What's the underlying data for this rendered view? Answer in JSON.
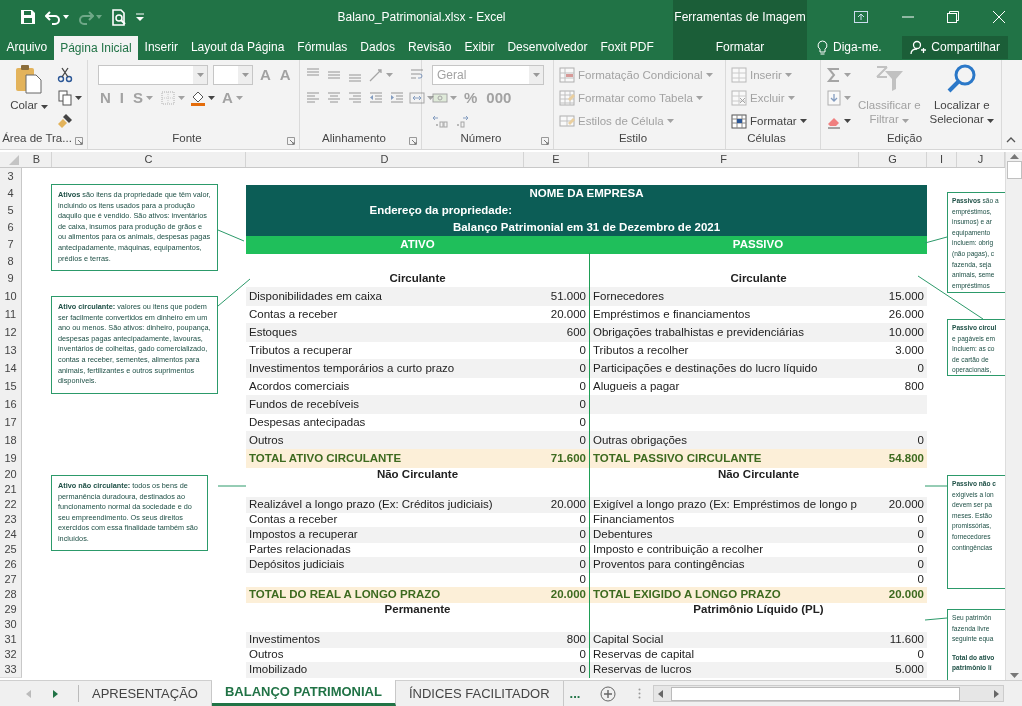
{
  "title_bar": {
    "title": "Balano_Patrimonial.xlsx - Excel",
    "context_title": "Ferramentas de Imagem"
  },
  "ribbon_tabs": [
    {
      "label": "Arquivo",
      "selected": false,
      "kind": "normal"
    },
    {
      "label": "Página Inicial",
      "selected": true,
      "kind": "normal"
    },
    {
      "label": "Inserir",
      "selected": false,
      "kind": "normal"
    },
    {
      "label": "Layout da Página",
      "selected": false,
      "kind": "normal"
    },
    {
      "label": "Fórmulas",
      "selected": false,
      "kind": "normal"
    },
    {
      "label": "Dados",
      "selected": false,
      "kind": "normal"
    },
    {
      "label": "Revisão",
      "selected": false,
      "kind": "normal"
    },
    {
      "label": "Exibir",
      "selected": false,
      "kind": "normal"
    },
    {
      "label": "Desenvolvedor",
      "selected": false,
      "kind": "normal"
    },
    {
      "label": "Foxit PDF",
      "selected": false,
      "kind": "normal"
    },
    {
      "label": "Formatar",
      "selected": false,
      "kind": "contextual"
    }
  ],
  "tell_me": "Diga-me.",
  "share": "Compartilhar",
  "ribbon_groups": [
    {
      "label": "Área de Tra...",
      "launcher": true,
      "parts": [
        {
          "kind": "large",
          "label": "Colar",
          "dropdown": true,
          "disabled": false
        },
        {
          "kind": "stack",
          "lines": [
            [
              {
                "kind": "icon",
                "dropdown": false,
                "disabled": false
              }
            ],
            [
              {
                "kind": "icon",
                "dropdown": true,
                "disabled": false
              }
            ],
            [
              {
                "kind": "icon",
                "dropdown": false,
                "disabled": false
              }
            ]
          ]
        }
      ]
    },
    {
      "label": "Fonte",
      "launcher": true,
      "parts": [
        {
          "kind": "stack",
          "lines": [
            [
              {
                "kind": "combo",
                "dropdown": true,
                "disabled": true
              },
              {
                "kind": "narrow-combo",
                "dropdown": true,
                "disabled": true
              },
              {
                "kind": "letter",
                "label": "A",
                "dropdown": false,
                "disabled": true
              },
              {
                "kind": "letter",
                "label": "A",
                "dropdown": false,
                "disabled": true
              }
            ],
            [
              {
                "kind": "letter",
                "label": "N",
                "dropdown": false,
                "disabled": true
              },
              {
                "kind": "letter",
                "label": "I",
                "dropdown": false,
                "disabled": true
              },
              {
                "kind": "letter",
                "label": "S",
                "dropdown": true,
                "disabled": true
              },
              {
                "kind": "icon",
                "dropdown": true,
                "disabled": true
              },
              {
                "kind": "icon",
                "dropdown": true,
                "disabled": false
              },
              {
                "kind": "letter",
                "label": "A",
                "dropdown": true,
                "disabled": true
              }
            ]
          ]
        }
      ]
    },
    {
      "label": "Alinhamento",
      "launcher": true,
      "parts": [
        {
          "kind": "stack",
          "lines": [
            [
              {
                "kind": "icon",
                "dropdown": false,
                "disabled": true
              },
              {
                "kind": "icon",
                "dropdown": false,
                "disabled": true
              },
              {
                "kind": "icon",
                "dropdown": false,
                "disabled": true
              },
              {
                "kind": "icon",
                "dropdown": true,
                "disabled": true
              }
            ],
            [
              {
                "kind": "icon",
                "dropdown": false,
                "disabled": true
              },
              {
                "kind": "icon",
                "dropdown": false,
                "disabled": true
              },
              {
                "kind": "icon",
                "dropdown": false,
                "disabled": true
              },
              {
                "kind": "icon",
                "dropdown": false,
                "disabled": true
              },
              {
                "kind": "icon",
                "dropdown": false,
                "disabled": true
              }
            ]
          ]
        },
        {
          "kind": "stack",
          "lines": [
            [
              {
                "kind": "icon",
                "dropdown": false,
                "disabled": true
              }
            ],
            [
              {
                "kind": "icon",
                "dropdown": true,
                "disabled": true
              }
            ]
          ]
        }
      ]
    },
    {
      "label": "Número",
      "launcher": true,
      "parts": [
        {
          "kind": "stack",
          "lines": [
            [
              {
                "kind": "combo",
                "value": "Geral",
                "dropdown": true,
                "disabled": true
              }
            ],
            [
              {
                "kind": "icon",
                "dropdown": true,
                "disabled": true
              },
              {
                "kind": "letter",
                "label": "%",
                "dropdown": false,
                "disabled": true
              },
              {
                "kind": "letter",
                "label": "000",
                "dropdown": false,
                "disabled": true
              }
            ],
            [
              {
                "kind": "icon",
                "dropdown": false,
                "disabled": true
              },
              {
                "kind": "icon",
                "dropdown": false,
                "disabled": true
              }
            ]
          ]
        }
      ]
    },
    {
      "label": "Estilo",
      "launcher": false,
      "parts": [
        {
          "kind": "stack",
          "lines": [
            [
              {
                "kind": "labeled",
                "label": "Formatação Condicional",
                "dropdown": true,
                "disabled": true
              }
            ],
            [
              {
                "kind": "labeled",
                "label": "Formatar como Tabela",
                "dropdown": true,
                "disabled": true
              }
            ],
            [
              {
                "kind": "labeled",
                "label": "Estilos de Célula",
                "dropdown": true,
                "disabled": true
              }
            ]
          ]
        }
      ]
    },
    {
      "label": "Células",
      "launcher": false,
      "parts": [
        {
          "kind": "stack",
          "lines": [
            [
              {
                "kind": "labeled",
                "label": "Inserir",
                "dropdown": true,
                "disabled": true
              }
            ],
            [
              {
                "kind": "labeled",
                "label": "Excluir",
                "dropdown": true,
                "disabled": true
              }
            ],
            [
              {
                "kind": "labeled",
                "label": "Formatar",
                "dropdown": true,
                "disabled": false
              }
            ]
          ]
        }
      ]
    },
    {
      "label": "Edição",
      "launcher": false,
      "parts": [
        {
          "kind": "stack",
          "lines": [
            [
              {
                "kind": "icon",
                "dropdown": true,
                "disabled": true
              }
            ],
            [
              {
                "kind": "icon",
                "dropdown": true,
                "disabled": true
              }
            ],
            [
              {
                "kind": "icon",
                "dropdown": true,
                "disabled": false
              }
            ]
          ]
        },
        {
          "kind": "large",
          "label": "Classificar e Filtrar",
          "dropdown": true,
          "disabled": true
        },
        {
          "kind": "large",
          "label": "Localizar e Selecionar",
          "dropdown": true,
          "disabled": false
        }
      ]
    }
  ],
  "sheet": {
    "columns": [
      "B",
      "C",
      "D",
      "E",
      "F",
      "G",
      "I",
      "J"
    ],
    "rows": [
      {
        "number": "3",
        "kind": "blank"
      },
      {
        "number": "4",
        "kind": "company",
        "text": "NOME DA EMPRESA"
      },
      {
        "number": "5",
        "kind": "address",
        "text": "Endereço da propriedade:"
      },
      {
        "number": "6",
        "kind": "company",
        "text": "Balanço Patrimonial em 31 de Dezembro de 2021"
      },
      {
        "number": "7",
        "kind": "header",
        "left": "ATIVO",
        "right": "PASSIVO"
      },
      {
        "number": "8",
        "kind": "blank"
      },
      {
        "number": "9",
        "kind": "section",
        "left": "Circulante",
        "right": "Circulante"
      },
      {
        "number": "10",
        "kind": "item",
        "left_label": "Disponibilidades em caixa",
        "left_value": "51.000",
        "right_label": "Fornecedores",
        "right_value": "15.000"
      },
      {
        "number": "11",
        "kind": "item",
        "left_label": "Contas a receber",
        "left_value": "20.000",
        "right_label": "Empréstimos e financiamentos",
        "right_value": "26.000"
      },
      {
        "number": "12",
        "kind": "item",
        "left_label": "Estoques",
        "left_value": "600",
        "right_label": "Obrigações trabalhistas e previdenciárias",
        "right_value": "10.000"
      },
      {
        "number": "13",
        "kind": "item",
        "left_label": "Tributos a recuperar",
        "left_value": "0",
        "right_label": "Tributos a recolher",
        "right_value": "3.000"
      },
      {
        "number": "14",
        "kind": "item",
        "left_label": "Investimentos temporários a curto prazo",
        "left_value": "0",
        "right_label": "Participações e destinações do lucro líquido",
        "right_value": "0"
      },
      {
        "number": "15",
        "kind": "item",
        "left_label": "Acordos comerciais",
        "left_value": "0",
        "right_label": "Alugueis a pagar",
        "right_value": "800"
      },
      {
        "number": "16",
        "kind": "item",
        "left_label": "Fundos de recebíveis",
        "left_value": "0"
      },
      {
        "number": "17",
        "kind": "item",
        "left_label": "Despesas antecipadas",
        "left_value": "0"
      },
      {
        "number": "18",
        "kind": "item",
        "left_label": "Outros",
        "left_value": "0",
        "right_label": "Outras obrigações",
        "right_value": "0"
      },
      {
        "number": "19",
        "kind": "total",
        "left_label": "TOTAL ATIVO CIRCULANTE",
        "left_value": "71.600",
        "right_label": "TOTAL PASSIVO CIRCULANTE",
        "right_value": "54.800"
      },
      {
        "number": "20",
        "kind": "section",
        "left": "Não Circulante",
        "right": "Não Circulante"
      },
      {
        "number": "21",
        "kind": "blank"
      },
      {
        "number": "22",
        "kind": "item",
        "left_label": "Realizável a longo prazo (Ex: Créditos judiciais)",
        "left_value": "20.000",
        "right_label": "Exigível a longo prazo (Ex: Empréstimos de longo p",
        "right_value": "20.000"
      },
      {
        "number": "23",
        "kind": "item",
        "left_label": "Contas a receber",
        "left_value": "0",
        "right_label": "Financiamentos",
        "right_value": "0"
      },
      {
        "number": "24",
        "kind": "item",
        "left_label": "Impostos a recuperar",
        "left_value": "0",
        "right_label": "Debentures",
        "right_value": "0"
      },
      {
        "number": "25",
        "kind": "item",
        "left_label": "Partes relacionadas",
        "left_value": "0",
        "right_label": "Imposto e contribuição a recolher",
        "right_value": "0"
      },
      {
        "number": "26",
        "kind": "item",
        "left_label": "Depósitos judiciais",
        "left_value": "0",
        "right_label": "Proventos para contingências",
        "right_value": "0"
      },
      {
        "number": "27",
        "kind": "item",
        "left_value": "0",
        "right_value": "0"
      },
      {
        "number": "28",
        "kind": "total",
        "left_label": "TOTAL DO REAL A LONGO PRAZO",
        "left_value": "20.000",
        "right_label": "TOTAL EXIGIDO A LONGO PRAZO",
        "right_value": "20.000"
      },
      {
        "number": "29",
        "kind": "section",
        "left": "Permanente",
        "right": "Patrimônio Líquido (PL)"
      },
      {
        "number": "30",
        "kind": "blank"
      },
      {
        "number": "31",
        "kind": "item",
        "left_label": "Investimentos",
        "left_value": "800",
        "right_label": "Capital Social",
        "right_value": "11.600"
      },
      {
        "number": "32",
        "kind": "item",
        "left_label": "Outros",
        "left_value": "0",
        "right_label": "Reservas de capital",
        "right_value": "0"
      },
      {
        "number": "33",
        "kind": "item",
        "left_label": "Imobilizado",
        "left_value": "0",
        "right_label": "Reservas de lucros",
        "right_value": "5.000"
      }
    ],
    "notes": [
      {
        "paragraphs": [
          "**Ativos** são itens da propriedade que têm valor, incluindo os itens usados para a produção daquilo que é vendido. São ativos: inventários de caixa, insumos para produção de grãos e ou alimentos para os animais, despesas pagas antecipadamente, máquinas, equipamentos, prédios e terras."
        ]
      },
      {
        "paragraphs": [
          "**Ativo circulante:** valores ou itens que podem ser facilmente convertidos em dinheiro em um ano ou menos. São ativos: dinheiro, poupança, despesas pagas antecipadamente, lavouras, inventários de colheitas, gado comercializado, contas a receber, sementes, alimentos para animais, fertilizantes e outros suprimentos disponíveis."
        ]
      },
      {
        "paragraphs": [
          "**Ativo não circulante:** todos os bens de permanência duradoura, destinados ao funcionamento normal da sociedade e do seu empreendimento. Os seus direitos exercidos com essa finalidade também são incluídos."
        ]
      },
      {
        "paragraphs": [
          "**Passivos** são a\nempréstimos,\ninsumos) e ar\nequipamento\nincluem: obrig\n(não pagas), c\nfazenda, seja\nanimais, seme\nempréstimos"
        ]
      },
      {
        "paragraphs": [
          "**Passivo circul**\ne pagáveis em\nIncluem: as co\nde cartão de\noperacionais,"
        ]
      },
      {
        "paragraphs": [
          "**Passivo não c**\nexigíveis a lon\ndevem ser pa\nmeses. Estão\npromissórias,\nfornecedores\ncontingências"
        ]
      },
      {
        "paragraphs": [
          "Seu patrimôn\nfazenda livre\nseguinte equa",
          "**Total do ativo**\n**patrimônio lí**"
        ]
      }
    ]
  },
  "sheet_tabs": [
    {
      "label": "APRESENTAÇÃO",
      "selected": false
    },
    {
      "label": "BALANÇO PATRIMONIAL",
      "selected": true
    },
    {
      "label": "ÍNDICES FACILITADOR",
      "selected": false
    }
  ],
  "sheet_tabs_more": "..."
}
